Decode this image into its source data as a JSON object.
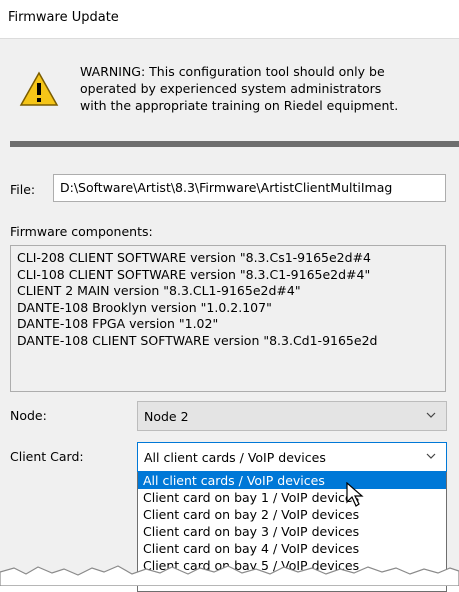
{
  "window": {
    "title": "Firmware Update"
  },
  "warning": {
    "icon": "warning-icon",
    "lines": [
      "WARNING: This configuration tool should only be",
      "operated by experienced system administrators",
      "with the appropriate training on Riedel equipment."
    ]
  },
  "file": {
    "label": "File:",
    "value": "D:\\Software\\Artist\\8.3\\Firmware\\ArtistClientMultiImag"
  },
  "firmware": {
    "label": "Firmware components:",
    "items": [
      "CLI-208 CLIENT SOFTWARE version \"8.3.Cs1-9165e2d#4",
      "CLI-108 CLIENT SOFTWARE version \"8.3.C1-9165e2d#4\"",
      "CLIENT 2 MAIN version \"8.3.CL1-9165e2d#4\"",
      "DANTE-108 Brooklyn version \"1.0.2.107\"",
      "DANTE-108 FPGA version \"1.02\"",
      "DANTE-108 CLIENT SOFTWARE version \"8.3.Cd1-9165e2d"
    ]
  },
  "node": {
    "label": "Node:",
    "value": "Node 2"
  },
  "client_card": {
    "label": "Client Card:",
    "value": "All client cards / VoIP devices",
    "options": [
      "All client cards / VoIP devices",
      "Client card on bay 1 / VoIP devices",
      "Client card on bay 2 / VoIP devices",
      "Client card on bay 3 / VoIP devices",
      "Client card on bay 4 / VoIP devices",
      "Client card on bay 5 / VoIP devices"
    ],
    "selected_index": 0
  },
  "colors": {
    "accent": "#0078d7",
    "warning_fill": "#f5c518",
    "separator": "#6e6e6e"
  }
}
